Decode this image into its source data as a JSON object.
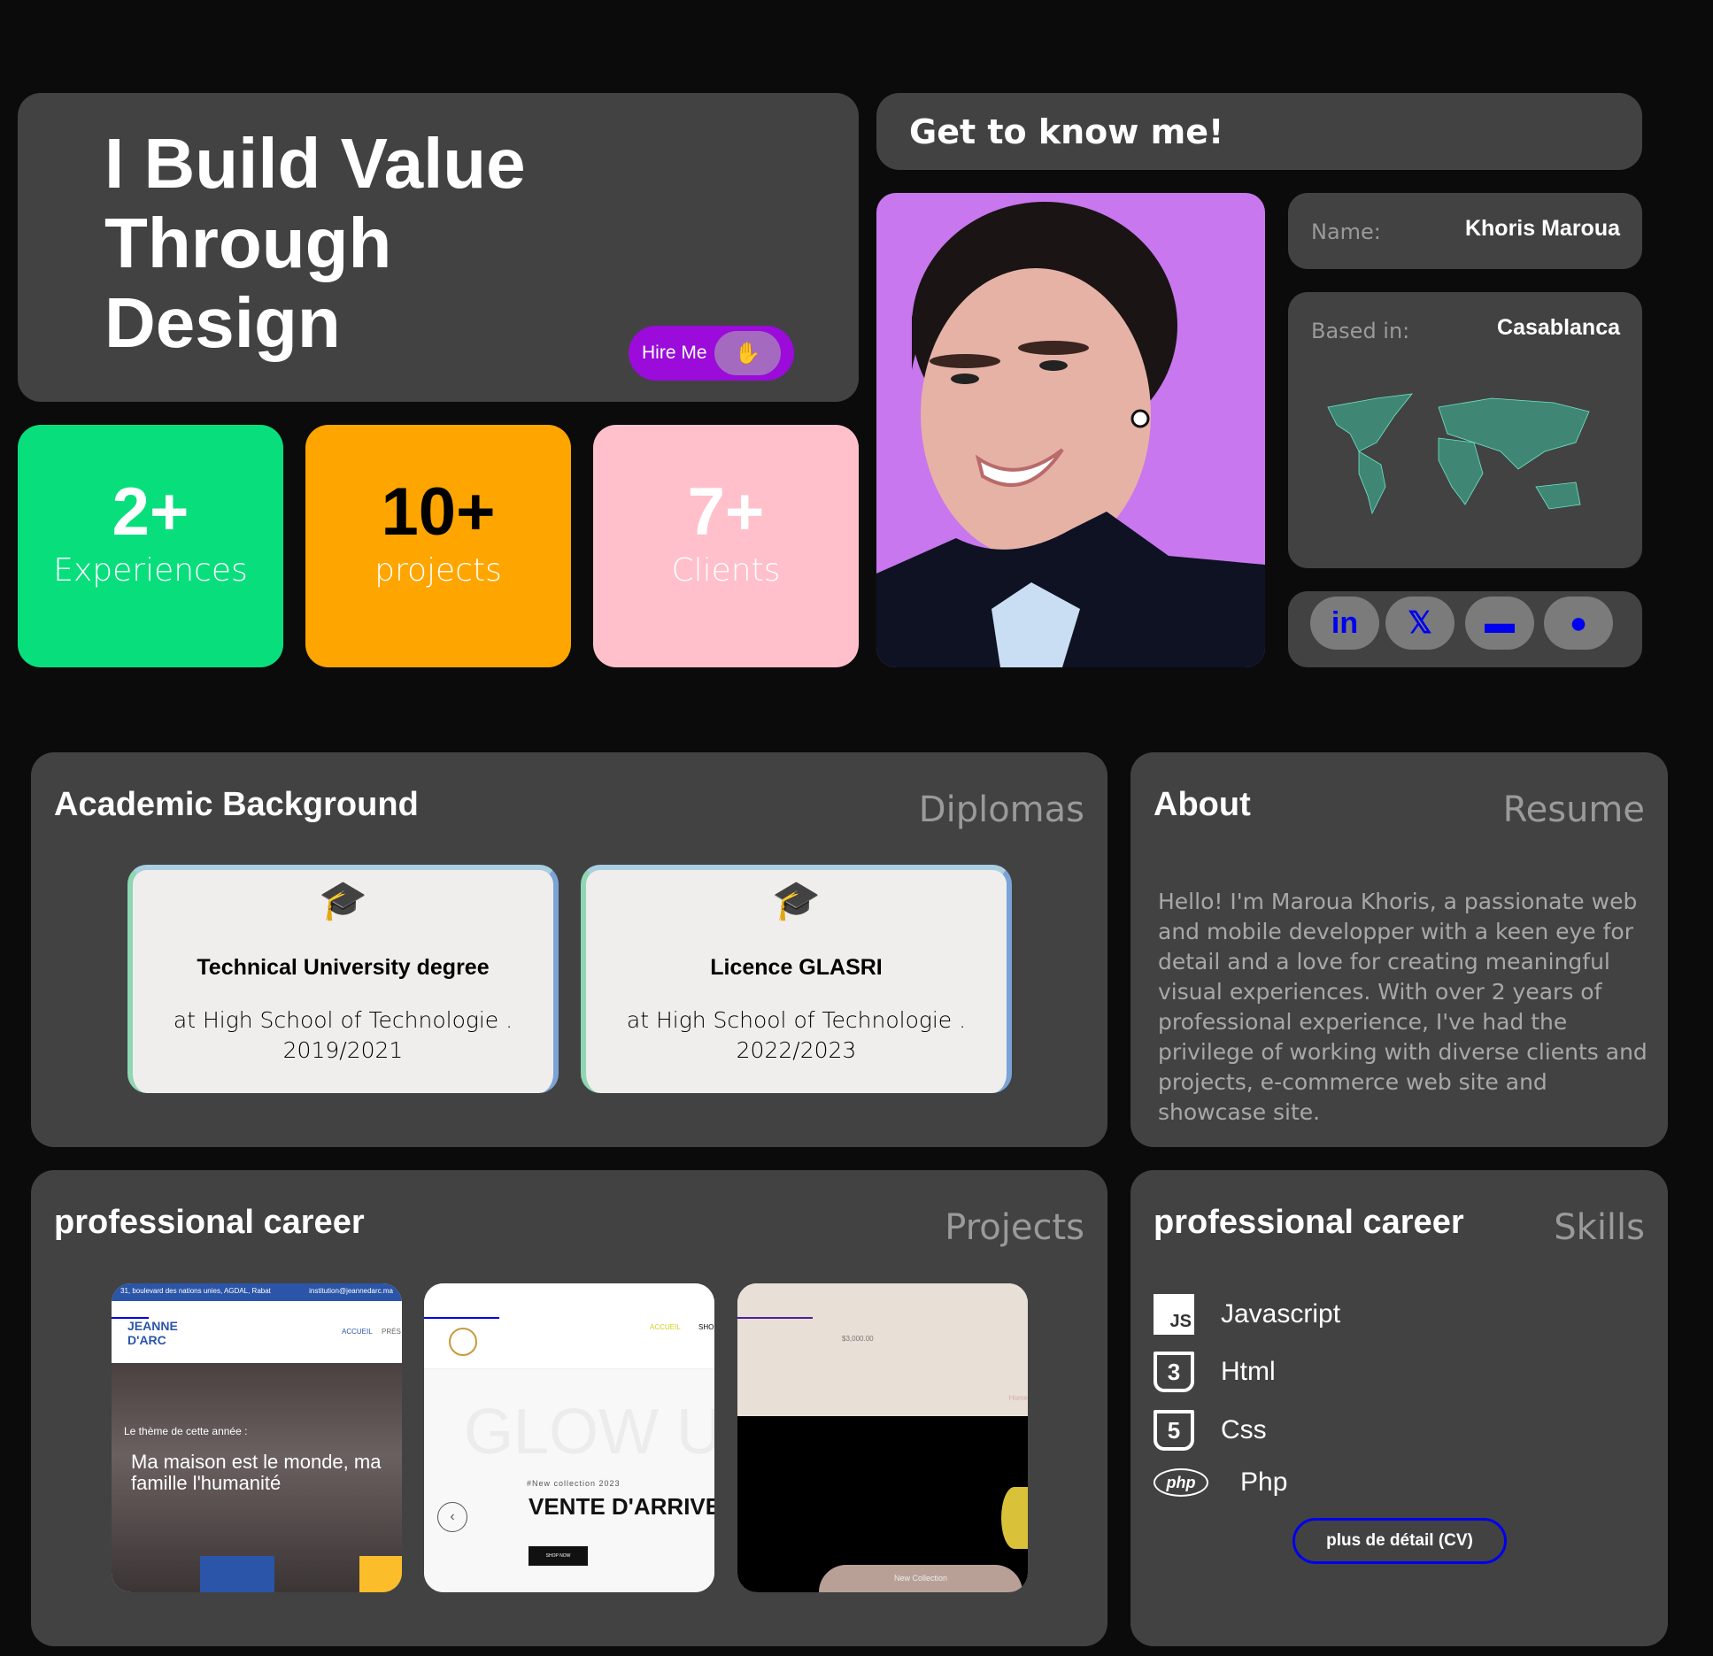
{
  "hero": {
    "title_lines": [
      "I Build Value",
      "Through",
      "Design"
    ],
    "hire_label": "Hire Me",
    "hire_icon": "waving-hand-icon"
  },
  "stats": [
    {
      "value": "2+",
      "label": "Experiences",
      "color": "#08df7c"
    },
    {
      "value": "10+",
      "label": "projects",
      "color": "#ffa500"
    },
    {
      "value": "7+",
      "label": "Clients",
      "color": "#ffc0cb"
    }
  ],
  "intro": {
    "title": "Get to know me!"
  },
  "profile": {
    "name_label": "Name:",
    "name_value": "Khoris Maroua",
    "based_label": "Based in:",
    "based_value": "Casablanca"
  },
  "social": [
    {
      "icon": "linkedin-icon",
      "glyph": "in"
    },
    {
      "icon": "x-twitter-icon",
      "glyph": "𝕏"
    },
    {
      "icon": "inbox-icon",
      "glyph": "▬"
    },
    {
      "icon": "github-icon",
      "glyph": "●"
    }
  ],
  "academic": {
    "title": "Academic Background",
    "tag": "Diplomas",
    "items": [
      {
        "degree": "Technical University degree",
        "school": "at High School of Technologie .",
        "years": "2019/2021"
      },
      {
        "degree": "Licence GLASRI",
        "school": "at High School of Technologie .",
        "years": "2022/2023"
      }
    ]
  },
  "about": {
    "title": "About",
    "tag": "Resume",
    "text": "Hello! I'm Maroua Khoris, a passionate web and mobile developper with a keen eye for detail and a love for creating meaningful visual experiences. With over 2 years of professional experience, I've had the privilege of working with diverse clients and projects, e-commerce web site and showcase site."
  },
  "career": {
    "title": "professional career",
    "tag": "Projects",
    "projects": [
      {
        "address": "31, boulevard des nations unies, AGDAL, Rabat",
        "email": "institution@jeannedarc.ma",
        "logo": "JEANNE D'ARC",
        "nav": "ACCUEIL",
        "nav2": "PRÉS",
        "theme": "Le thème de cette année :",
        "headline": "Ma maison est le monde, ma famille l'humanité"
      },
      {
        "nav": "ACCUEIL",
        "nav2": "SHO",
        "bg_word": "GLOW U",
        "kicker": "#New collection 2023",
        "headline": "VENTE D'ARRIVE",
        "cta": "SHOP NOW"
      },
      {
        "price": "$3,000.00",
        "home": "Home",
        "badge": "New Collection"
      }
    ]
  },
  "skills": {
    "title": "professional career",
    "tag": "Skills",
    "items": [
      {
        "name": "Javascript",
        "icon": "js-icon",
        "glyph": "JS"
      },
      {
        "name": "Html",
        "icon": "html5-icon",
        "glyph": "3"
      },
      {
        "name": "Css",
        "icon": "css3-icon",
        "glyph": "5"
      },
      {
        "name": "Php",
        "icon": "php-icon",
        "glyph": "php"
      }
    ],
    "cv_button": "plus de détail (CV)"
  }
}
